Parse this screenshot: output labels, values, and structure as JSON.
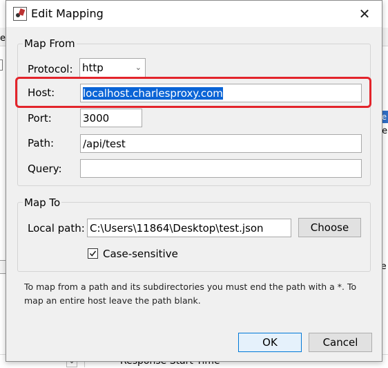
{
  "background": {
    "left_fragment": "e",
    "right_blue_fragment": "te",
    "right_fragment": "te",
    "right_row_fragment": "le",
    "bottom_text": "Response Start Time  -"
  },
  "dialog": {
    "title": "Edit Mapping",
    "map_from": {
      "group_label": "Map From",
      "protocol_label": "Protocol:",
      "protocol_value": "http",
      "host_label": "Host:",
      "host_value": "localhost.charlesproxy.com",
      "port_label": "Port:",
      "port_value": "3000",
      "path_label": "Path:",
      "path_value": "/api/test",
      "query_label": "Query:",
      "query_value": ""
    },
    "map_to": {
      "group_label": "Map To",
      "local_path_label": "Local path:",
      "local_path_value": "C:\\Users\\11864\\Desktop\\test.json",
      "choose_label": "Choose",
      "case_sensitive_label": "Case-sensitive",
      "case_sensitive_checked": true
    },
    "note": "To map from a path and its subdirectories you must end the path with a *. To map an entire host leave the path blank.",
    "ok_label": "OK",
    "cancel_label": "Cancel"
  },
  "colors": {
    "highlight": "#e3242b",
    "selection": "#0a64d6"
  }
}
